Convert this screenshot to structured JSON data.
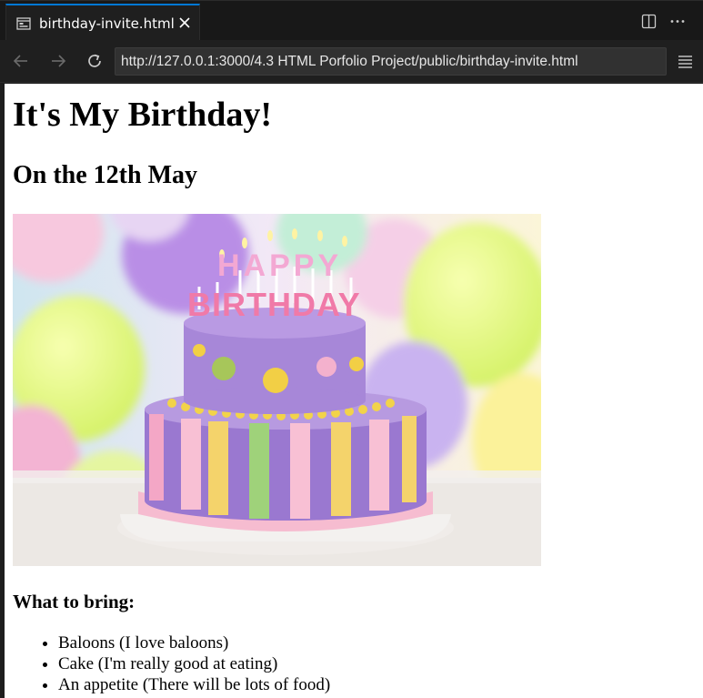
{
  "tab": {
    "title": "birthday-invite.html"
  },
  "address_bar": {
    "url": "http://127.0.0.1:3000/4.3 HTML Porfolio Project/public/birthday-invite.html"
  },
  "icons": {
    "tab": "browser-preview-icon",
    "close": "close-icon",
    "split": "split-editor-icon",
    "more": "more-actions-icon",
    "back": "arrow-left-icon",
    "forward": "arrow-right-icon",
    "reload": "reload-icon",
    "menu": "hamburger-menu-icon"
  },
  "colors": {
    "accent": "#0078d4",
    "chrome_bg": "#1f1f1f",
    "page_bg": "#ffffff"
  },
  "page": {
    "heading": "It's My Birthday!",
    "date": "On the 12th May",
    "image_text": "HAPPY BIRTHDAY",
    "bring_heading": "What to bring:",
    "bring_items": [
      "Baloons (I love baloons)",
      "Cake (I'm really good at eating)",
      "An appetite (There will be lots of food)"
    ]
  }
}
